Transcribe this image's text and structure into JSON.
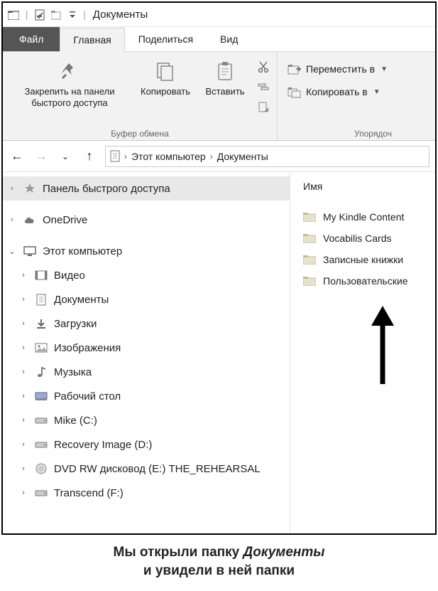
{
  "titlebar": {
    "title": "Документы"
  },
  "tabs": {
    "file": "Файл",
    "home": "Главная",
    "share": "Поделиться",
    "view": "Вид"
  },
  "ribbon": {
    "pin": "Закрепить на панели быстрого доступа",
    "copy": "Копировать",
    "paste": "Вставить",
    "group_clipboard": "Буфер обмена",
    "move_to": "Переместить в",
    "copy_to": "Копировать в",
    "group_organize": "Упорядоч"
  },
  "addr": {
    "root": "Этот компьютер",
    "current": "Документы"
  },
  "tree": {
    "quick_access": "Панель быстрого доступа",
    "onedrive": "OneDrive",
    "this_pc": "Этот компьютер",
    "children": [
      "Видео",
      "Документы",
      "Загрузки",
      "Изображения",
      "Музыка",
      "Рабочий стол",
      "Mike (C:)",
      "Recovery Image (D:)",
      "DVD RW дисковод (E:) THE_REHEARSAL",
      "Transcend (F:)"
    ]
  },
  "content": {
    "column_name": "Имя",
    "folders": [
      "My Kindle Content",
      "Vocabilis Cards",
      "Записные книжки",
      "Пользовательские"
    ]
  },
  "caption": {
    "line1_a": "Мы открыли папку ",
    "line1_b": "Документы",
    "line2": "и увидели в ней папки"
  }
}
